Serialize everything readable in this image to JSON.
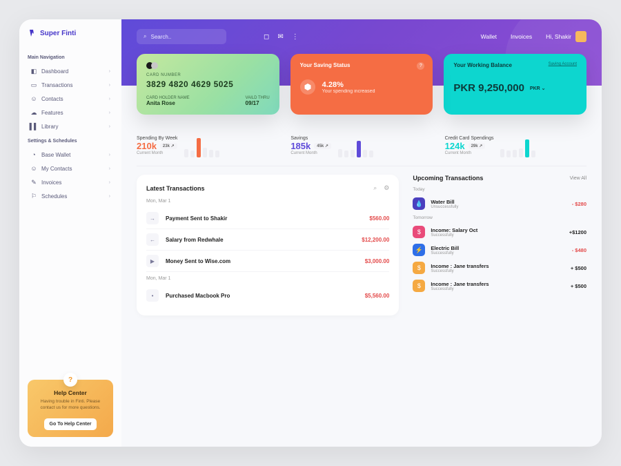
{
  "brand": "Super Finti",
  "sidebar": {
    "section1": "Main Navigation",
    "items1": [
      {
        "label": "Dashboard",
        "icon": "◧"
      },
      {
        "label": "Transactions",
        "icon": "▭"
      },
      {
        "label": "Contacts",
        "icon": "☺"
      },
      {
        "label": "Features",
        "icon": "☁"
      },
      {
        "label": "Library",
        "icon": "▌▌"
      }
    ],
    "section2": "Settings & Schedules",
    "items2": [
      {
        "label": "Base Wallet",
        "icon": "◔"
      },
      {
        "label": "My Contacts",
        "icon": "☺"
      },
      {
        "label": "Invoices",
        "icon": "✎"
      },
      {
        "label": "Schedules",
        "icon": "⚐"
      }
    ]
  },
  "help": {
    "title": "Help Center",
    "desc": "Having trouble in Finti. Please contact us for more questions.",
    "button": "Go To Help Center"
  },
  "topbar": {
    "search_placeholder": "Search..",
    "nav1": "Wallet",
    "nav2": "Invoices",
    "greet": "Hi, Shakir"
  },
  "card_credit": {
    "num_label": "CARD NUMBER",
    "number": "3829 4820 4629 5025",
    "holder_label": "CARD HOLDER NAME",
    "holder": "Anita Rose",
    "thru_label": "VAILD THRU",
    "thru": "09/17"
  },
  "card_saving": {
    "title": "Your Saving Status",
    "pct": "4.28%",
    "sub": "Your spending increased"
  },
  "card_balance": {
    "title": "Your Working Balance",
    "link": "Saving Account",
    "amount": "PKR 9,250,000",
    "currency": "PKR"
  },
  "stats": [
    {
      "title": "Spending By Week",
      "value": "210k",
      "badge": "23k ↗",
      "sub": "Current Month"
    },
    {
      "title": "Savings",
      "value": "185k",
      "badge": "45k ↗",
      "sub": "Current Month"
    },
    {
      "title": "Credit Card Spendings",
      "value": "124k",
      "badge": "29k ↗",
      "sub": "Current Month"
    }
  ],
  "tx": {
    "title": "Latest Transactions",
    "groups": [
      {
        "date": "Mon, Mar 1",
        "rows": [
          {
            "name": "Payment Sent to Shakir",
            "amount": "$560.00",
            "icon": "→"
          },
          {
            "name": "Salary from Redwhale",
            "amount": "$12,200.00",
            "icon": "←"
          },
          {
            "name": "Money Sent to Wise.com",
            "amount": "$3,000.00",
            "icon": "▶"
          }
        ]
      },
      {
        "date": "Mon, Mar 1",
        "rows": [
          {
            "name": "Purchased Macbook Pro",
            "amount": "$5,560.00",
            "icon": "•"
          }
        ]
      }
    ]
  },
  "upcoming": {
    "title": "Upcoming Transactions",
    "viewall": "View All",
    "groups": [
      {
        "date": "Today",
        "rows": [
          {
            "name": "Water Bill",
            "sub": "Unsuccessfully",
            "amount": "- $280",
            "neg": true,
            "ic": "indigo",
            "glyph": "💧"
          }
        ]
      },
      {
        "date": "Tomorrow",
        "rows": [
          {
            "name": "Income: Salary Oct",
            "sub": "Successfully",
            "amount": "+$1200",
            "neg": false,
            "ic": "pink",
            "glyph": "$"
          },
          {
            "name": "Electric Bill",
            "sub": "Successfully",
            "amount": "- $480",
            "neg": true,
            "ic": "blue",
            "glyph": "⚡"
          },
          {
            "name": "Income : Jane transfers",
            "sub": "Successfully",
            "amount": "+ $500",
            "neg": false,
            "ic": "amber",
            "glyph": "$"
          },
          {
            "name": "Income : Jane transfers",
            "sub": "Successfully",
            "amount": "+ $500",
            "neg": false,
            "ic": "amber",
            "glyph": "$"
          }
        ]
      }
    ]
  },
  "chart_data": [
    {
      "type": "bar",
      "title": "Spending By Week",
      "values": [
        12,
        10,
        28,
        14,
        11,
        10
      ],
      "highlight_index": 2,
      "ylim": [
        0,
        30
      ]
    },
    {
      "type": "bar",
      "title": "Savings",
      "values": [
        12,
        10,
        11,
        24,
        11,
        10
      ],
      "highlight_index": 3,
      "ylim": [
        0,
        30
      ]
    },
    {
      "type": "bar",
      "title": "Credit Card Spendings",
      "values": [
        12,
        10,
        11,
        13,
        26,
        10
      ],
      "highlight_index": 4,
      "ylim": [
        0,
        30
      ]
    }
  ]
}
